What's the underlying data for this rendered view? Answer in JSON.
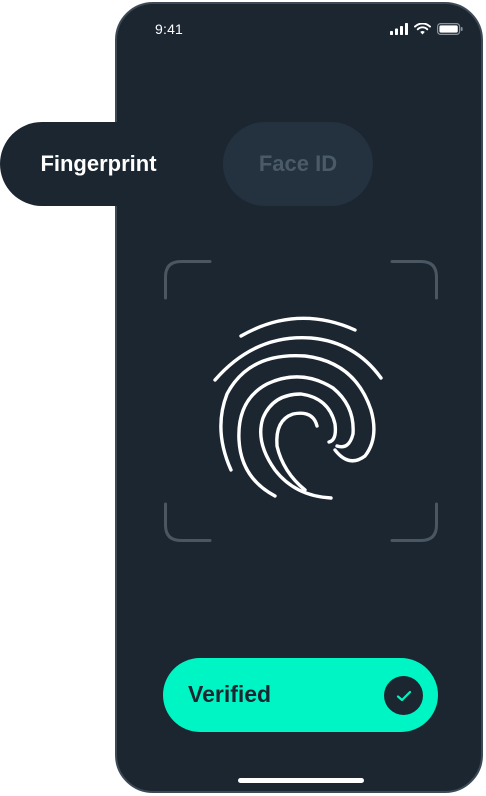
{
  "status_bar": {
    "time": "9:41"
  },
  "auth_tabs": {
    "fingerprint_label": "Fingerprint",
    "faceid_label": "Face ID",
    "selected": "Fingerprint"
  },
  "scanner": {
    "icon": "fingerprint-icon"
  },
  "verified_pill": {
    "label": "Verified",
    "icon": "checkmark-icon"
  },
  "colors": {
    "phone_background": "#1b2631",
    "accent": "#00f5c4",
    "inactive_tab": "#243240",
    "inactive_text": "#4b5a67",
    "frame_corner": "#4a5762"
  }
}
